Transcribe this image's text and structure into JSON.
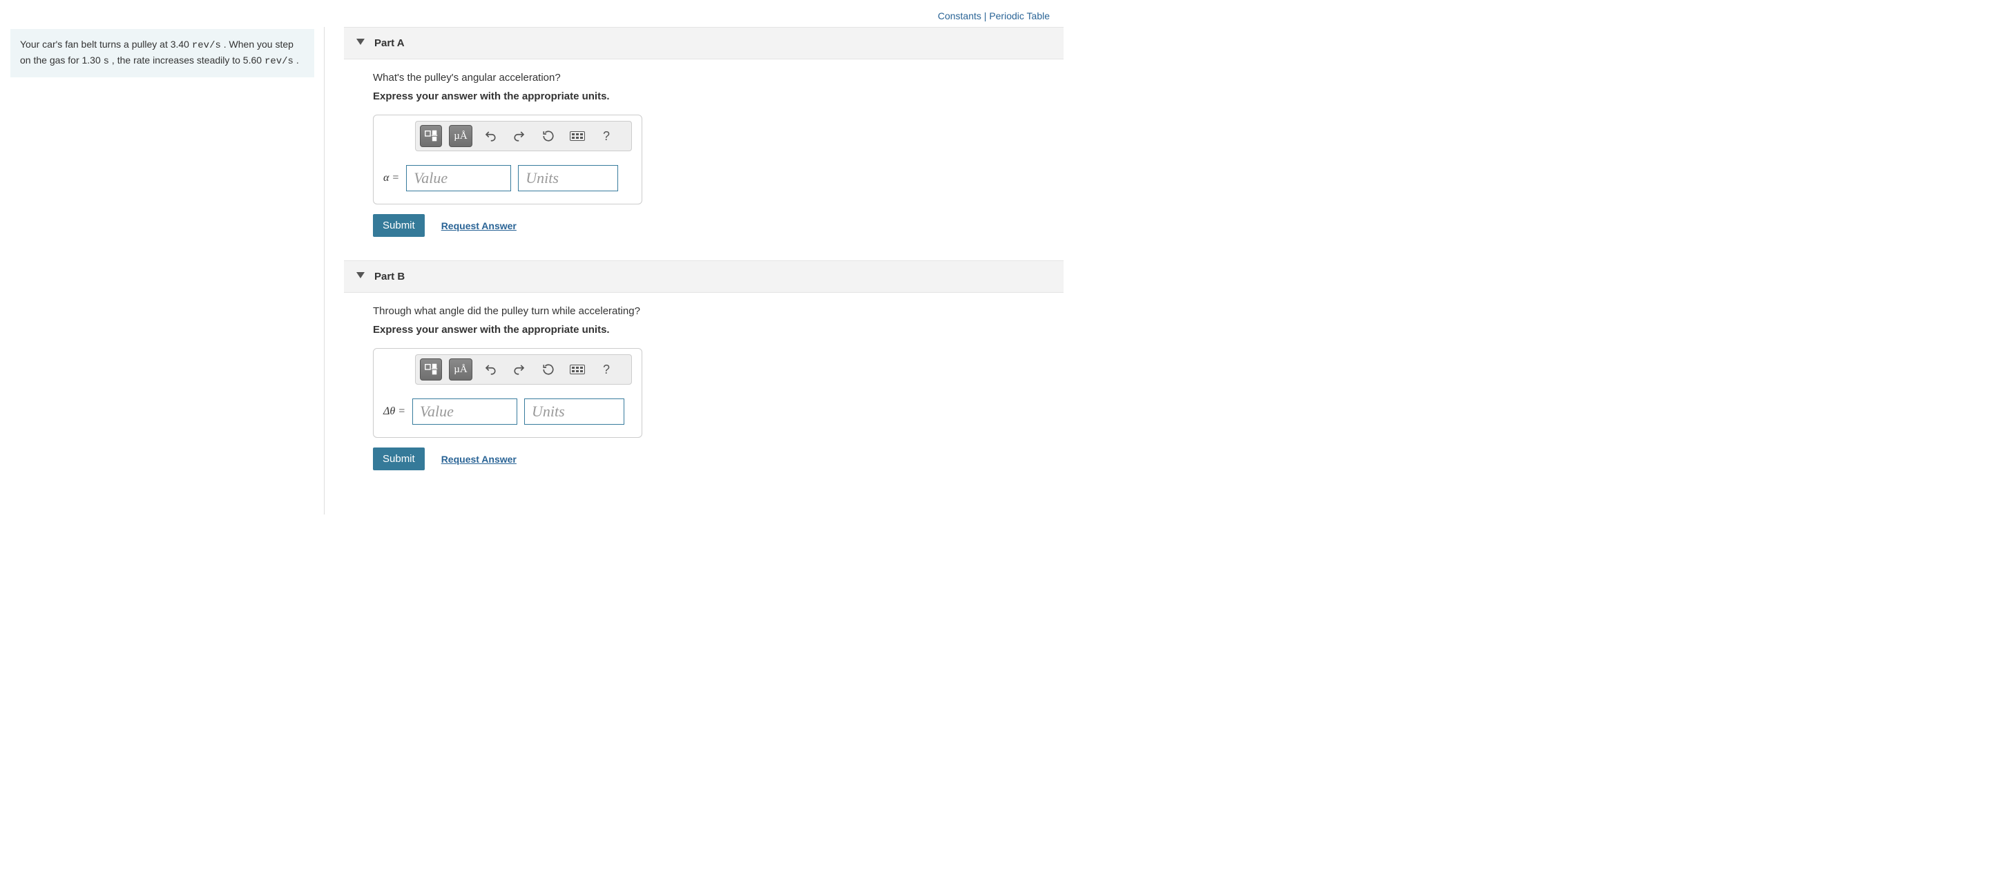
{
  "header": {
    "constants": "Constants",
    "separator": " | ",
    "periodic": "Periodic Table"
  },
  "problem": {
    "text_pre": "Your car's fan belt turns a pulley at 3.40 ",
    "unit1": "rev/s",
    "text_mid": " . When you step on the gas for 1.30 ",
    "unit_s": "s",
    "text_mid2": " , the rate increases steadily to 5.60 ",
    "unit2": "rev/s",
    "text_end": " ."
  },
  "parts": [
    {
      "label": "Part A",
      "question": "What's the pulley's angular acceleration?",
      "instruction": "Express your answer with the appropriate units.",
      "var": "α =",
      "tools": {
        "mua": "µÅ",
        "help": "?"
      },
      "value_ph": "Value",
      "units_ph": "Units",
      "submit": "Submit",
      "request": "Request Answer"
    },
    {
      "label": "Part B",
      "question": "Through what angle did the pulley turn while accelerating?",
      "instruction": "Express your answer with the appropriate units.",
      "var": "Δθ =",
      "tools": {
        "mua": "µÅ",
        "help": "?"
      },
      "value_ph": "Value",
      "units_ph": "Units",
      "submit": "Submit",
      "request": "Request Answer"
    }
  ]
}
